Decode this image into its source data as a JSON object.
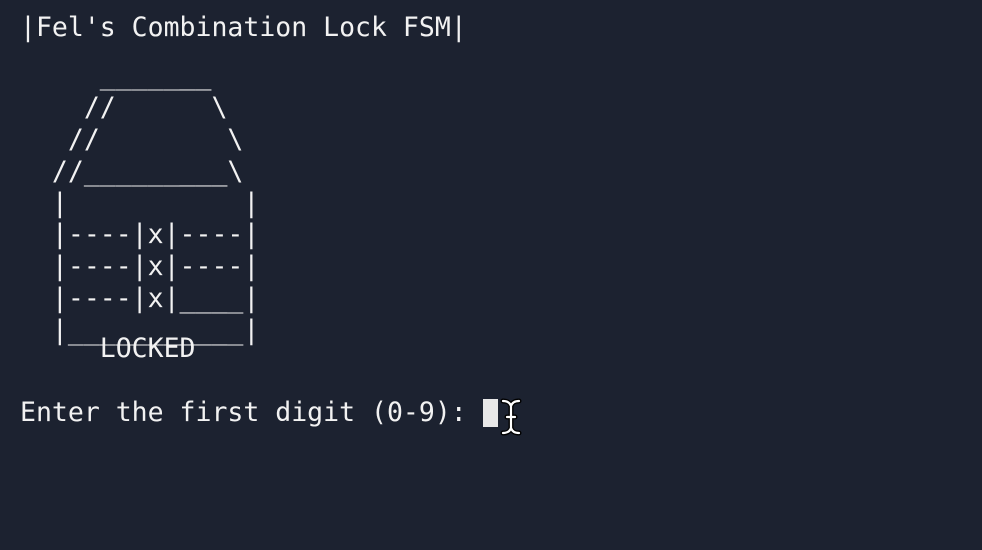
{
  "terminal": {
    "title": "|Fel's Combination Lock FSM|",
    "lock_art": [
      "     _______",
      "    //      \\",
      "   //        \\",
      "  //_________\\",
      "  |           |",
      "  |----|x|----|",
      "  |----|x|----|",
      "  |----|x|____|",
      "  |___________|"
    ],
    "status": "     LOCKED",
    "prompt": "Enter the first digit (0-9): ",
    "input_value": "",
    "colors": {
      "background": "#1c2230",
      "foreground": "#f2f2f2",
      "cursor": "#e8e8e8"
    }
  }
}
